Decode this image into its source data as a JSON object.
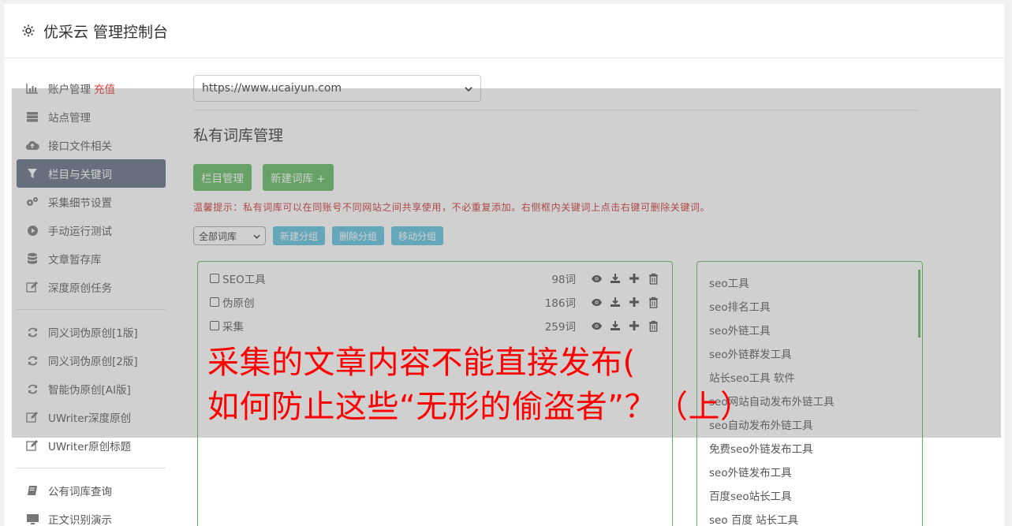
{
  "header": {
    "title": "优采云 管理控制台",
    "icon": "gear-icon"
  },
  "sidebar": {
    "group1": [
      {
        "label": "账户管理",
        "extra": "充值",
        "icon": "bar-chart-icon"
      },
      {
        "label": "站点管理",
        "icon": "server-icon"
      },
      {
        "label": "接口文件相关",
        "icon": "cloud-upload-icon"
      },
      {
        "label": "栏目与关键词",
        "icon": "filter-icon",
        "active": true
      },
      {
        "label": "采集细节设置",
        "icon": "cogs-icon"
      },
      {
        "label": "手动运行测试",
        "icon": "play-circle-icon"
      },
      {
        "label": "文章暂存库",
        "icon": "database-icon"
      },
      {
        "label": "深度原创任务",
        "icon": "edit-icon"
      }
    ],
    "group2": [
      {
        "label": "同义词伪原创[1版]",
        "icon": "refresh-icon"
      },
      {
        "label": "同义词伪原创[2版]",
        "icon": "refresh-icon"
      },
      {
        "label": "智能伪原创[AI版]",
        "icon": "refresh-icon"
      },
      {
        "label": "UWriter深度原创",
        "icon": "edit-icon"
      },
      {
        "label": "UWriter原创标题",
        "icon": "edit-icon"
      }
    ],
    "group3": [
      {
        "label": "公有词库查询",
        "icon": "book-icon"
      },
      {
        "label": "正文识别演示",
        "icon": "monitor-icon"
      }
    ]
  },
  "main": {
    "site_select": "https://www.ucaiyun.com",
    "heading": "私有词库管理",
    "btn_columns": "栏目管理",
    "btn_new_lib": "新建词库 +",
    "tip": "温馨提示：私有词库可以在同账号不同网站之间共享使用，不必重复添加。右侧框内关键词上点击右键可删除关键词。",
    "filter_select": "全部词库",
    "btn_new_group": "新建分组",
    "btn_delete_group": "删除分组",
    "btn_move_group": "移动分组",
    "libraries": [
      {
        "name": "SEO工具",
        "count": "98词"
      },
      {
        "name": "伪原创",
        "count": "186词"
      },
      {
        "name": "采集",
        "count": "259词"
      }
    ],
    "keywords": [
      "seo工具",
      "seo排名工具",
      "seo外链工具",
      "seo外链群发工具",
      "站长seo工具 软件",
      "seo网站自动发布外链工具",
      "seo自动发布外链工具",
      "免费seo外链发布工具",
      "seo外链发布工具",
      "百度seo站长工具",
      "seo 百度 站长工具"
    ]
  },
  "overlay": {
    "line1": "采集的文章内容不能直接发布(",
    "line2": "如何防止这些“无形的偷盗者”？（上）"
  },
  "colors": {
    "accent_green": "#5cb85c",
    "accent_blue": "#5bc0de",
    "active_nav": "#5c6a7d",
    "alert_red": "#ff0000"
  }
}
